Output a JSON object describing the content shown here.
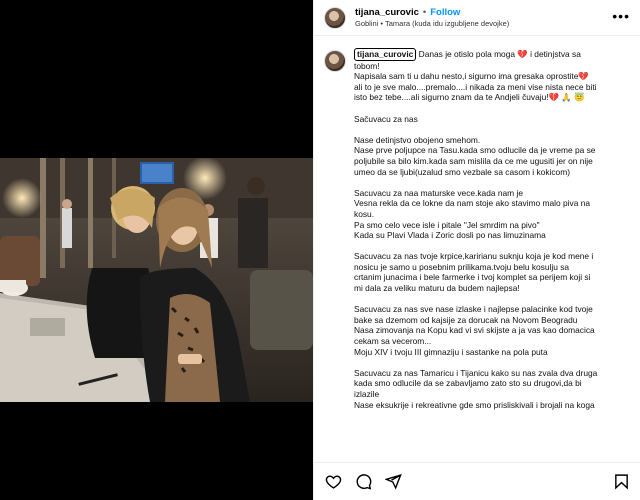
{
  "post": {
    "username": "tijana_curovic",
    "follow_label": "Follow",
    "separator": "•",
    "audio": "Goblini • Tamara (kuda idu izgubljene devojke)",
    "more_label": "•••"
  },
  "caption": {
    "username": "tijana_curovic",
    "paragraphs": [
      [
        "Danas je otislo pola moga 💔  i detinjstva sa",
        "tobom!",
        "Napisala sam ti u dahu nesto,i sigurno ima gresaka oprostite💔",
        "ali to je sve malo....premalo....i nikada za meni vise nista nece biti",
        "isto bez tebe....ali sigurno znam da te Andjeli čuvaju!💔 🙏 😇"
      ],
      [
        "Sačuvacu za nas"
      ],
      [
        "Nase detinjstvo obojeno smehom.",
        "Nase prve poljupce na Tasu.kada smo odlucile da je vreme pa se",
        "poljubile sa bilo kim.kada sam mislila da ce me ugusiti jer on nije",
        "umeo da se ljubi(uzalud smo vezbale sa casom i kokicom)"
      ],
      [
        "Sacuvacu za naa maturske vece.kada nam je",
        "Vesna rekla da ce lokne da nam stoje ako stavimo malo piva na",
        "kosu.",
        "Pa smo celo vece isle i pitale \"Jel smrdim na pivo\"",
        "Kada su Plavi Vlada i Zoric dosli po nas limuzinama"
      ],
      [
        "Sacuvacu za nas tvoje krpice,karirianu suknju koja je kod mene i",
        "nosicu je samo u posebnim prilikama.tvoju belu kosulju sa",
        "crtanim junacima i bele farmerke i tvoj komplet sa perijem koji si",
        "mi dala za veliku maturu da budem najlepsa!"
      ],
      [
        "Sacuvacu za nas sve nase izlaske i najlepse palacinke kod tvoje",
        "bake sa dzemom od kajsije za dorucak na Novom Beogradu",
        "Nasa zimovanja na Kopu kad vi svi skijste a ja vas kao domacica",
        "cekam sa vecerom...",
        "Moju XIV i tvoju III gimnaziju i sastanke na pola puta"
      ],
      [
        "Sacuvacu za nas Tamaricu i Tijanicu kako su nas zvala dva druga",
        "kada smo odlucile da se zabavljamo zato sto su drugovi,da bi",
        "izlazile",
        "Nase eksukrije i rekreativne gde smo prisliskivali i brojali na koga"
      ]
    ]
  },
  "icons": {
    "like": "heart-icon",
    "comment": "comment-icon",
    "share": "share-icon",
    "save": "bookmark-icon"
  }
}
